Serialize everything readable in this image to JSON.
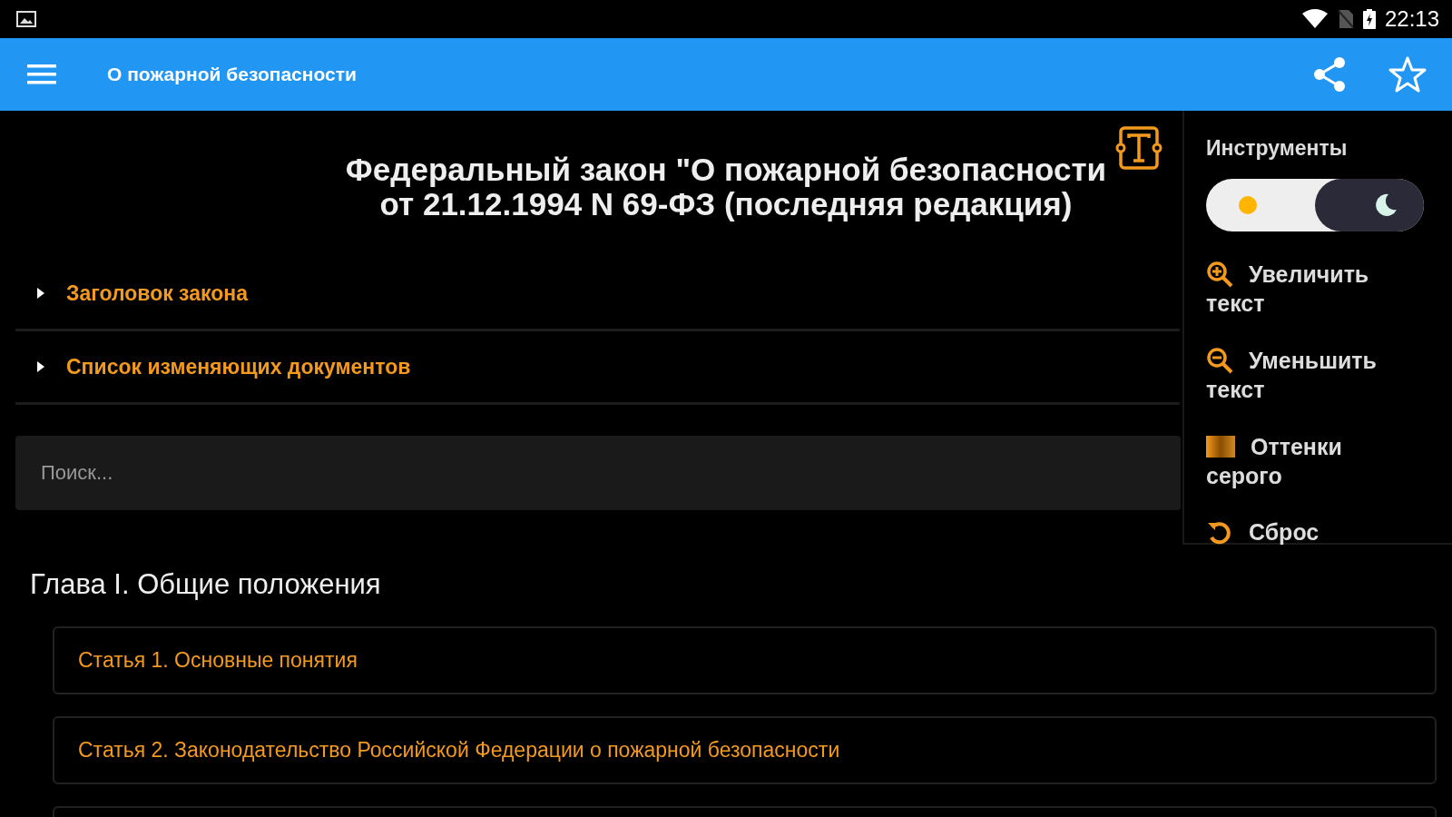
{
  "status_bar": {
    "time": "22:13"
  },
  "app_bar": {
    "title": "О пожарной безопасности"
  },
  "document": {
    "title_line_1": "Федеральный закон \"О пожарной безопасности",
    "title_line_2": "от 21.12.1994 N 69-ФЗ (последняя редакция)"
  },
  "sections": [
    {
      "label": "Заголовок закона",
      "expanded": false
    },
    {
      "label": "Список изменяющих документов",
      "expanded": false
    }
  ],
  "search": {
    "placeholder": "Поиск..."
  },
  "tools": {
    "title": "Инструменты",
    "dark_mode": true,
    "items": [
      {
        "kind": "zoom_in",
        "label": "Увеличить текст"
      },
      {
        "kind": "zoom_out",
        "label": "Уменьшить текст"
      },
      {
        "kind": "grayscale",
        "label": "Оттенки серого"
      },
      {
        "kind": "reset",
        "label": "Сброс"
      }
    ]
  },
  "chapter": {
    "title": "Глава I. Общие положения"
  },
  "articles": [
    "Статья 1. Основные понятия",
    "Статья 2. Законодательство Российской Федерации о пожарной безопасности"
  ]
}
